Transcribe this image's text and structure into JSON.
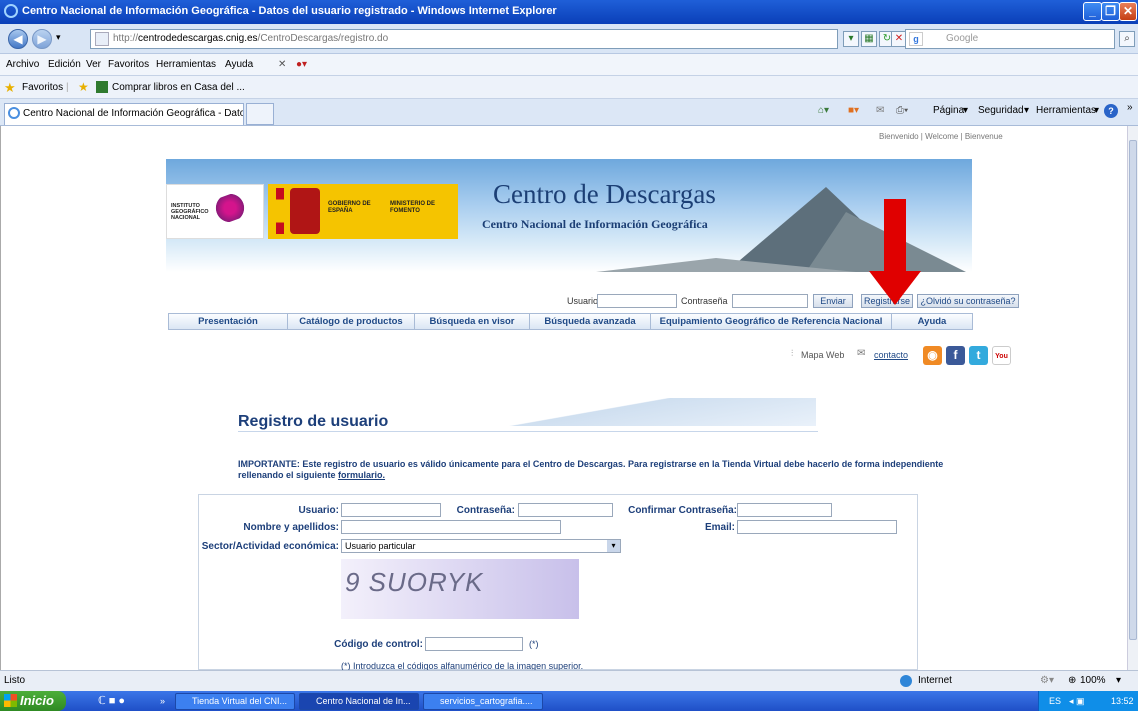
{
  "window": {
    "title": "Centro Nacional de Información Geográfica - Datos del usuario registrado - Windows Internet Explorer"
  },
  "address": {
    "url_prefix": "http://",
    "url_domain": "centrodedescargas.cnig.es",
    "url_path": "/CentroDescargas/registro.do",
    "search_placeholder": "Google"
  },
  "menu": [
    "Archivo",
    "Edición",
    "Ver",
    "Favoritos",
    "Herramientas",
    "Ayuda"
  ],
  "favorites": {
    "label": "Favoritos",
    "link": "Comprar libros en Casa del ..."
  },
  "tab": {
    "title": "Centro Nacional de Información Geográfica - Datos de..."
  },
  "commandbar": {
    "pagina": "Página",
    "seguridad": "Seguridad",
    "herramientas": "Herramientas"
  },
  "page": {
    "welcome": "Bienvenido | Welcome | Bienvenue",
    "banner_title": "Centro de Descargas",
    "banner_subtitle": "Centro Nacional de Información Geográfica",
    "ign_logo_text": "INSTITUTO GEOGRÁFICO NACIONAL",
    "gov_logo_1": "GOBIERNO DE ESPAÑA",
    "gov_logo_2": "MINISTERIO DE FOMENTO",
    "login": {
      "usuario_label": "Usuario",
      "password_label": "Contraseña",
      "enviar": "Enviar",
      "registrarse": "Registrarse",
      "olvido": "¿Olvidó su contraseña?"
    },
    "nav": [
      "Presentación",
      "Catálogo de productos",
      "Búsqueda en visor",
      "Búsqueda avanzada",
      "Equipamiento Geográfico de Referencia Nacional",
      "Ayuda"
    ],
    "mapa_web": "Mapa Web",
    "contacto": "contacto",
    "social": [
      "rss",
      "facebook",
      "twitter",
      "youtube"
    ],
    "registro_title": "Registro de usuario",
    "important_bold": "IMPORTANTE:",
    "important_text": " Este registro de usuario es válido únicamente para el Centro de Descargas. Para registrarse en la Tienda Virtual debe hacerlo de forma independiente rellenando el siguiente ",
    "important_link": "formulario.",
    "form": {
      "usuario": "Usuario:",
      "contrasena": "Contraseña:",
      "confirmar": "Confirmar Contraseña:",
      "nombre": "Nombre y apellidos:",
      "email": "Email:",
      "sector": "Sector/Actividad económica:",
      "sector_value": "Usuario particular",
      "captcha": "9 SUORYK",
      "codigo": "Código de control:",
      "asterisk": "(*)",
      "nota": "(*) Introduzca el códigos alfanumérico de la imagen superior."
    }
  },
  "status": {
    "text": "Listo",
    "zone": "Internet",
    "zoom": "100%"
  },
  "taskbar": {
    "start": "Inicio",
    "tasks": [
      "Tienda Virtual del CNI...",
      "Centro Nacional de In...",
      "servicios_cartografia...."
    ],
    "lang": "ES",
    "time": "13:52"
  },
  "colors": {
    "accent": "#1f5fd8",
    "arrow": "#e00000",
    "link": "#204a87"
  }
}
